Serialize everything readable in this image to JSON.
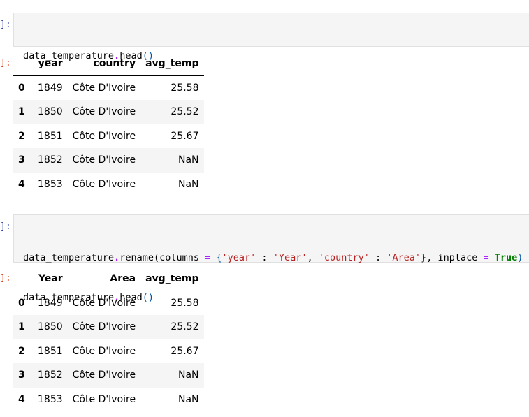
{
  "cells": {
    "cell1": {
      "in_prompt": "]:",
      "out_prompt": "]:",
      "code": {
        "obj": "data_temperature",
        "dot": ".",
        "method": "head",
        "parens": "()"
      }
    },
    "cell2": {
      "in_prompt": "]:",
      "out_prompt": "]:",
      "code": {
        "line1_obj": "data_temperature",
        "line1_dot": ".",
        "line1_method": "rename(columns ",
        "line1_eq": "=",
        "line1_brace_open": " {",
        "line1_s1": "'year'",
        "line1_colon1": " : ",
        "line1_s2": "'Year'",
        "line1_comma1": ", ",
        "line1_s3": "'country'",
        "line1_colon2": " : ",
        "line1_s4": "'Area'",
        "line1_close": "}, inplace ",
        "line1_eq2": "=",
        "line1_space": " ",
        "line1_true": "True",
        "line1_end": ")",
        "line2_obj": "data_temperature",
        "line2_dot": ".",
        "line2_method": "head",
        "line2_parens": "()"
      }
    }
  },
  "table1": {
    "headers": [
      "",
      "year",
      "country",
      "avg_temp"
    ],
    "rows": [
      {
        "index": "0",
        "year": "1849",
        "country": "Côte D'Ivoire",
        "avg_temp": "25.58"
      },
      {
        "index": "1",
        "year": "1850",
        "country": "Côte D'Ivoire",
        "avg_temp": "25.52"
      },
      {
        "index": "2",
        "year": "1851",
        "country": "Côte D'Ivoire",
        "avg_temp": "25.67"
      },
      {
        "index": "3",
        "year": "1852",
        "country": "Côte D'Ivoire",
        "avg_temp": "NaN"
      },
      {
        "index": "4",
        "year": "1853",
        "country": "Côte D'Ivoire",
        "avg_temp": "NaN"
      }
    ]
  },
  "table2": {
    "headers": [
      "",
      "Year",
      "Area",
      "avg_temp"
    ],
    "rows": [
      {
        "index": "0",
        "year": "1849",
        "country": "Côte D'Ivoire",
        "avg_temp": "25.58"
      },
      {
        "index": "1",
        "year": "1850",
        "country": "Côte D'Ivoire",
        "avg_temp": "25.52"
      },
      {
        "index": "2",
        "year": "1851",
        "country": "Côte D'Ivoire",
        "avg_temp": "25.67"
      },
      {
        "index": "3",
        "year": "1852",
        "country": "Côte D'Ivoire",
        "avg_temp": "NaN"
      },
      {
        "index": "4",
        "year": "1853",
        "country": "Côte D'Ivoire",
        "avg_temp": "NaN"
      }
    ]
  }
}
